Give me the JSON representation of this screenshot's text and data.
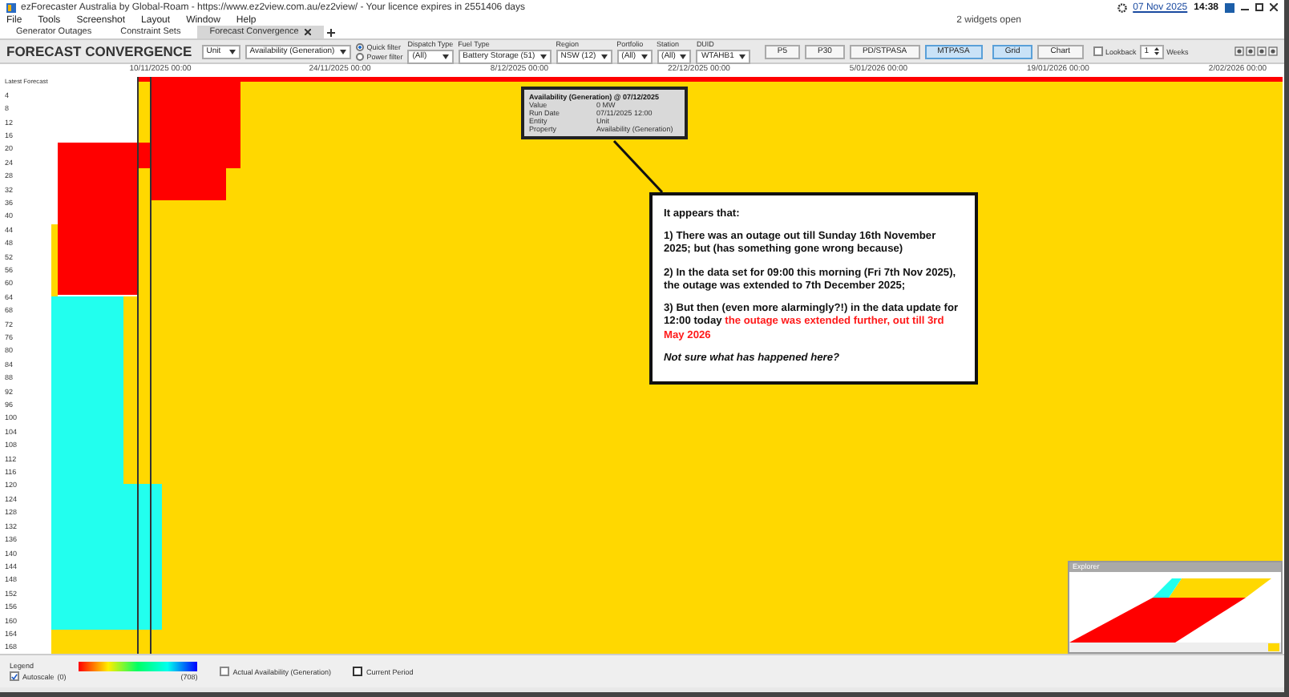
{
  "window": {
    "title": "ezForecaster Australia by Global-Roam - https://www.ez2view.com.au/ez2view/ - Your licence expires in 2551406 days",
    "date": "07 Nov 2025",
    "time": "14:38",
    "status": "2 widgets open"
  },
  "menu": [
    "File",
    "Tools",
    "Screenshot",
    "Layout",
    "Window",
    "Help"
  ],
  "tabs": [
    {
      "label": "Generator Outages",
      "selected": false
    },
    {
      "label": "Constraint Sets",
      "selected": false
    },
    {
      "label": "Forecast Convergence",
      "selected": true
    }
  ],
  "toolbar": {
    "title": "FORECAST CONVERGENCE",
    "entity": "Unit",
    "property": "Availability (Generation)",
    "filter_modes": [
      {
        "label": "Quick filter",
        "selected": true
      },
      {
        "label": "Power filter",
        "selected": false
      }
    ],
    "filters": [
      {
        "label": "Dispatch Type",
        "value": "(All)"
      },
      {
        "label": "Fuel Type",
        "value": "Battery Storage (51)"
      },
      {
        "label": "Region",
        "value": "NSW (12)"
      },
      {
        "label": "Portfolio",
        "value": "(All)"
      },
      {
        "label": "Station",
        "value": "(All)"
      },
      {
        "label": "DUID",
        "value": "WTAHB1"
      }
    ],
    "sources": [
      {
        "label": "P5",
        "selected": false
      },
      {
        "label": "P30",
        "selected": false
      },
      {
        "label": "PD/STPASA",
        "selected": false
      },
      {
        "label": "MTPASA",
        "selected": true
      }
    ],
    "views": [
      {
        "label": "Grid",
        "selected": true
      },
      {
        "label": "Chart",
        "selected": false
      }
    ],
    "lookback": {
      "label": "Lookback",
      "checked": false,
      "value": "1",
      "unit": "Weeks"
    }
  },
  "chart": {
    "axis_title": "Latest Forecast",
    "x_ticks": [
      "10/11/2025 00:00",
      "24/11/2025 00:00",
      "8/12/2025 00:00",
      "22/12/2025 00:00",
      "5/01/2026 00:00",
      "19/01/2026 00:00",
      "2/02/2026 00:00"
    ],
    "y_labels": [
      "4",
      "8",
      "12",
      "16",
      "20",
      "24",
      "28",
      "32",
      "36",
      "40",
      "44",
      "48",
      "52",
      "56",
      "60",
      "64",
      "68",
      "72",
      "76",
      "80",
      "84",
      "88",
      "92",
      "96",
      "100",
      "104",
      "108",
      "112",
      "116",
      "120",
      "124",
      "128",
      "132",
      "136",
      "140",
      "144",
      "148",
      "152",
      "156",
      "160",
      "164",
      "168"
    ]
  },
  "tooltip": {
    "title": "Availability (Generation) @ 07/12/2025",
    "rows": [
      {
        "key": "Value",
        "value": "0 MW"
      },
      {
        "key": "Run Date",
        "value": "07/11/2025 12:00"
      },
      {
        "key": "Entity",
        "value": "Unit"
      },
      {
        "key": "Property",
        "value": "Availability (Generation)"
      }
    ]
  },
  "callout": {
    "paragraphs": [
      {
        "kind": "text",
        "segments": [
          {
            "text": "It appears that:",
            "highlight": false
          }
        ]
      },
      {
        "kind": "text",
        "segments": [
          {
            "text": "1)  There was an outage out till Sunday 16th November 2025; but (has something gone wrong because)",
            "highlight": false
          }
        ]
      },
      {
        "kind": "text",
        "segments": [
          {
            "text": "2)  In the data set for 09:00 this morning (Fri 7th Nov 2025), the outage was extended to 7th December 2025;",
            "highlight": false
          }
        ]
      },
      {
        "kind": "text",
        "segments": [
          {
            "text": "3)  But then (even more alarmingly?!) in the data update for 12:00 today ",
            "highlight": false
          },
          {
            "text": "the outage was extended further, out till 3rd May 2026",
            "highlight": true
          }
        ]
      },
      {
        "kind": "note",
        "segments": [
          {
            "text": "Not sure what has happened here?",
            "highlight": false
          }
        ]
      }
    ]
  },
  "explorer": {
    "title": "Explorer"
  },
  "legend": {
    "title": "Legend",
    "autoscale": {
      "label": "Autoscale",
      "checked": true
    },
    "min": "(0)",
    "max": "(708)",
    "toggles": [
      {
        "label": "Actual Availability (Generation)",
        "checked": false
      },
      {
        "label": "Current Period",
        "checked": false
      }
    ]
  }
}
